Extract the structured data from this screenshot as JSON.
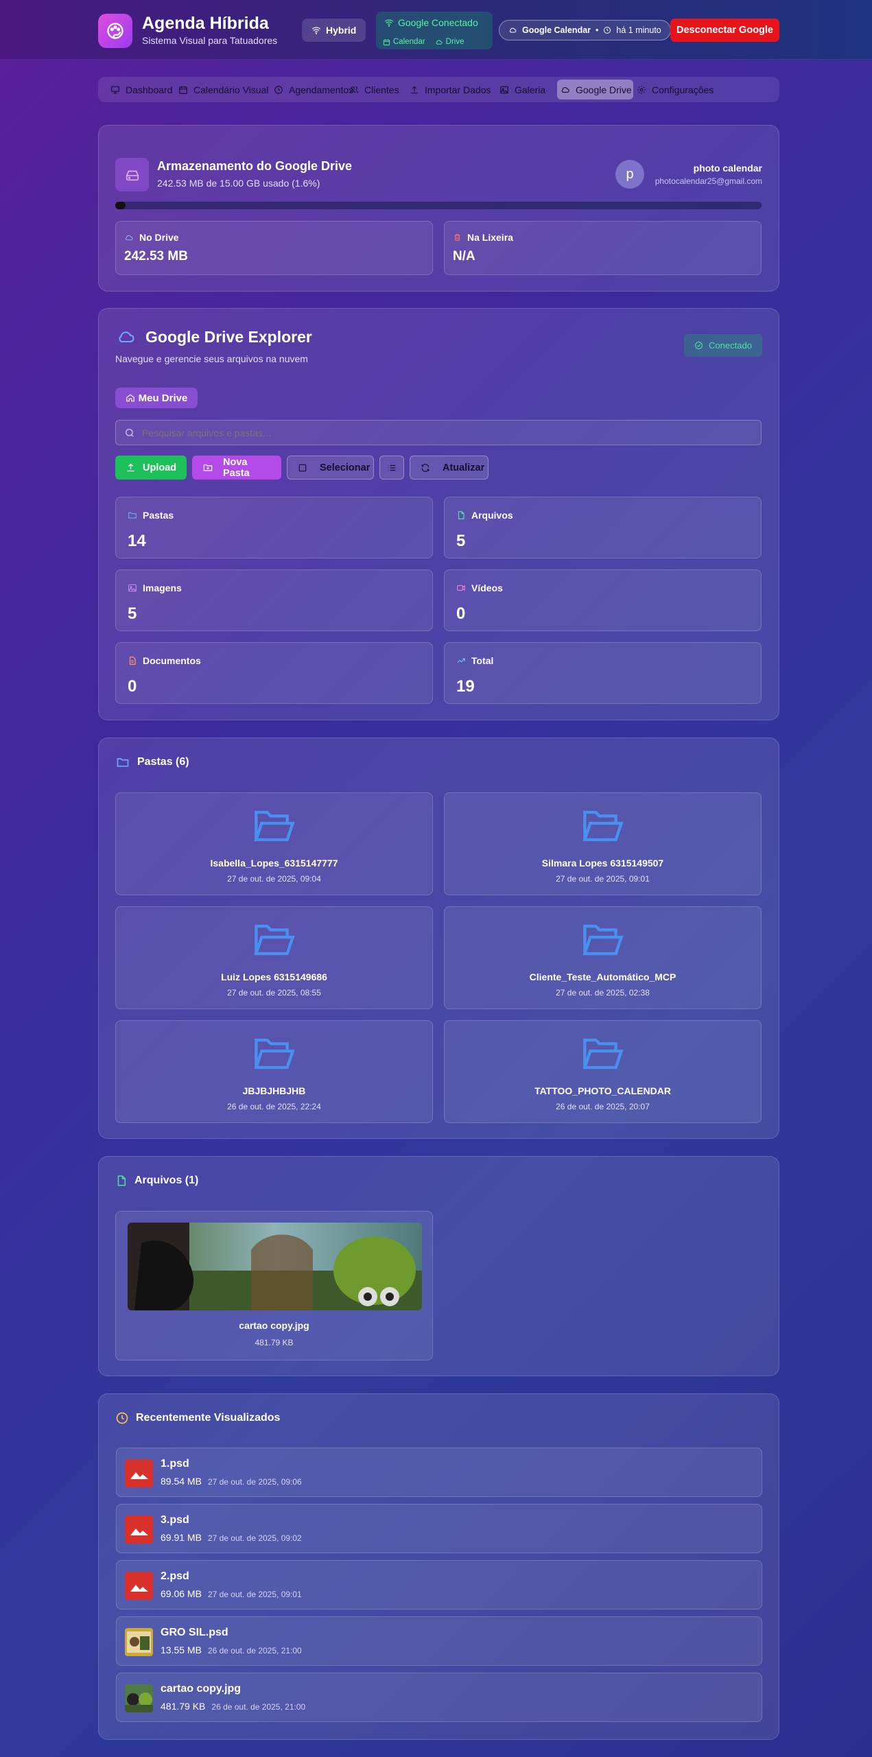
{
  "header": {
    "title": "Agenda Híbrida",
    "subtitle": "Sistema Visual para Tatuadores",
    "mode": "Hybrid",
    "google_status": "Google Conectado",
    "google_calendar": "Calendar",
    "google_drive": "Drive",
    "sync_label": "Google Calendar",
    "sync_sep": "•",
    "sync_time": "há 1 minuto",
    "disconnect": "Desconectar Google"
  },
  "nav": [
    {
      "label": "Dashboard",
      "icon": "monitor-icon"
    },
    {
      "label": "Calendário Visual",
      "icon": "calendar-icon"
    },
    {
      "label": "Agendamentos",
      "icon": "clock-icon"
    },
    {
      "label": "Clientes",
      "icon": "users-icon"
    },
    {
      "label": "Importar Dados",
      "icon": "upload-icon"
    },
    {
      "label": "Galeria",
      "icon": "image-icon"
    },
    {
      "label": "Google Drive",
      "icon": "cloud-icon",
      "active": true
    },
    {
      "label": "Configurações",
      "icon": "gear-icon"
    }
  ],
  "storage": {
    "title": "Armazenamento do Google Drive",
    "usage": "242.53 MB de 15.00 GB usado (1.6%)",
    "used_fraction": 0.016,
    "account_initial": "p",
    "account_name": "photo calendar",
    "account_email": "photocalendar25@gmail.com",
    "drive_label": "No Drive",
    "drive_value": "242.53 MB",
    "trash_label": "Na Lixeira",
    "trash_value": "N/A"
  },
  "explorer": {
    "title": "Google Drive Explorer",
    "subtitle": "Navegue e gerencie seus arquivos na nuvem",
    "status": "Conectado",
    "breadcrumb": "Meu Drive",
    "search_placeholder": "Pesquisar arquivos e pastas...",
    "btn_upload": "Upload",
    "btn_new_folder": "Nova Pasta",
    "btn_select": "Selecionar",
    "btn_refresh": "Atualizar",
    "stats": [
      {
        "label": "Pastas",
        "value": "14",
        "color": "#6fa8ff"
      },
      {
        "label": "Arquivos",
        "value": "5",
        "color": "#4fe0a0"
      },
      {
        "label": "Imagens",
        "value": "5",
        "color": "#c58af5"
      },
      {
        "label": "Vídeos",
        "value": "0",
        "color": "#f47ad1"
      },
      {
        "label": "Documentos",
        "value": "0",
        "color": "#ff9a5a"
      },
      {
        "label": "Total",
        "value": "19",
        "color": "#5ac8ff"
      }
    ]
  },
  "folders": {
    "title": "Pastas (6)",
    "items": [
      {
        "name": "Isabella_Lopes_6315147777",
        "date": "27 de out. de 2025, 09:04"
      },
      {
        "name": "Silmara Lopes 6315149507",
        "date": "27 de out. de 2025, 09:01"
      },
      {
        "name": "Luiz Lopes 6315149686",
        "date": "27 de out. de 2025, 08:55"
      },
      {
        "name": "Cliente_Teste_Automático_MCP",
        "date": "27 de out. de 2025, 02:38"
      },
      {
        "name": "JBJBJHBJHB",
        "date": "26 de out. de 2025, 22:24"
      },
      {
        "name": "TATTOO_PHOTO_CALENDAR",
        "date": "26 de out. de 2025, 20:07"
      }
    ]
  },
  "files": {
    "title": "Arquivos (1)",
    "items": [
      {
        "name": "cartao copy.jpg",
        "size": "481.79 KB"
      }
    ]
  },
  "recent": {
    "title": "Recentemente Visualizados",
    "items": [
      {
        "name": "1.psd",
        "size": "89.54 MB",
        "date": "27 de out. de 2025, 09:06",
        "thumb": "psd"
      },
      {
        "name": "3.psd",
        "size": "69.91 MB",
        "date": "27 de out. de 2025, 09:02",
        "thumb": "psd"
      },
      {
        "name": "2.psd",
        "size": "69.06 MB",
        "date": "27 de out. de 2025, 09:01",
        "thumb": "psd"
      },
      {
        "name": "GRO SIL.psd",
        "size": "13.55 MB",
        "date": "26 de out. de 2025, 21:00",
        "thumb": "photo"
      },
      {
        "name": "cartao copy.jpg",
        "size": "481.79 KB",
        "date": "26 de out. de 2025, 21:00",
        "thumb": "photo2"
      }
    ]
  }
}
